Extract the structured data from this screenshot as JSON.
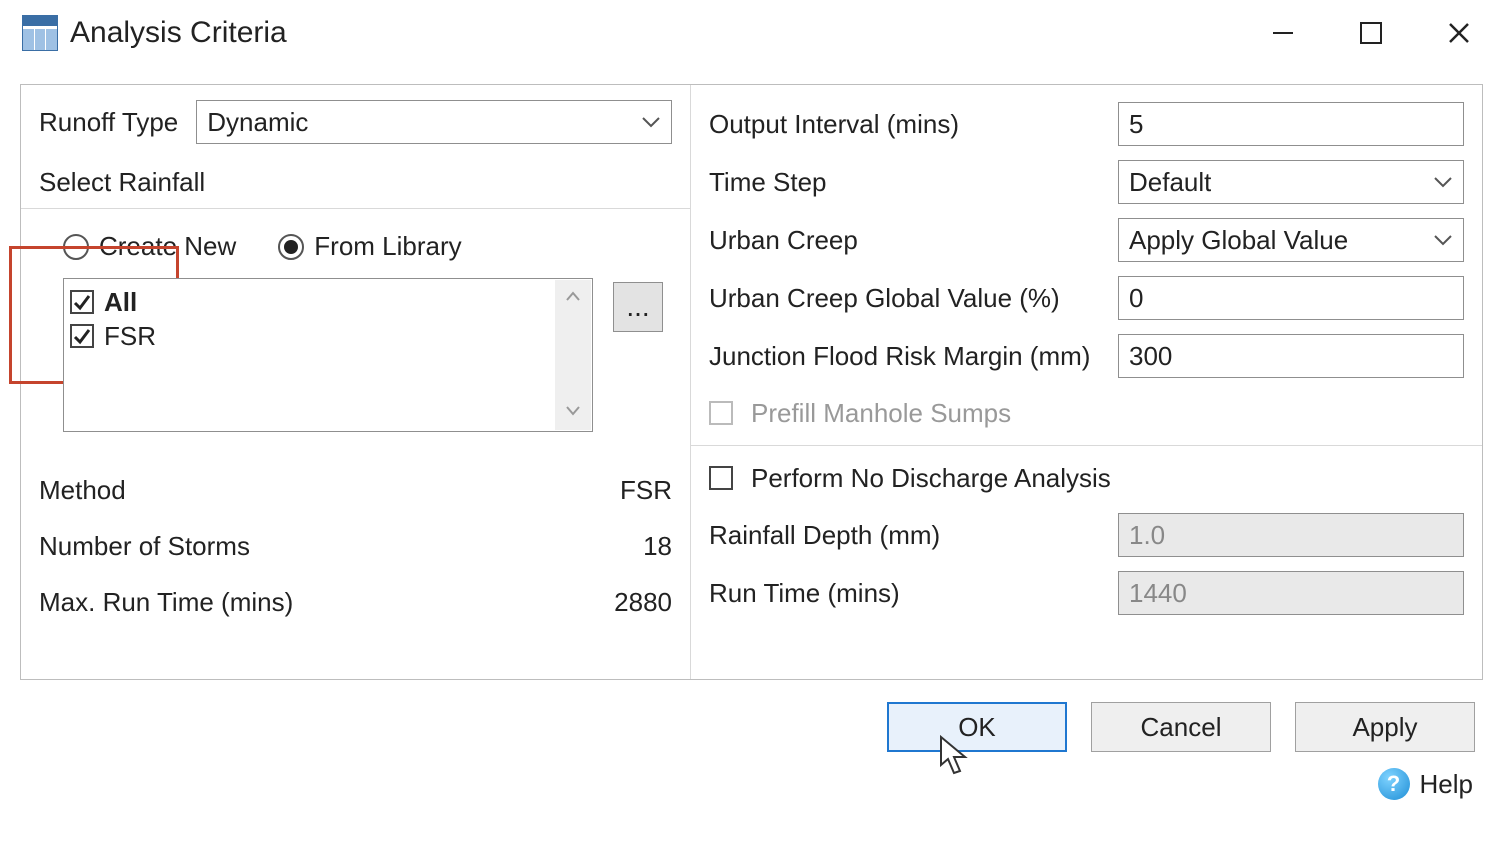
{
  "window": {
    "title": "Analysis Criteria"
  },
  "left": {
    "runoff_type_label": "Runoff Type",
    "runoff_type_value": "Dynamic",
    "select_rainfall_label": "Select Rainfall",
    "radio_create_new": "Create New",
    "radio_from_library": "From Library",
    "rainfall_source": "from_library",
    "library_items": [
      {
        "label": "All",
        "checked": true,
        "bold": true
      },
      {
        "label": "FSR",
        "checked": true,
        "bold": false
      }
    ],
    "browse_label": "...",
    "stats": {
      "method_label": "Method",
      "method_value": "FSR",
      "storms_label": "Number of Storms",
      "storms_value": "18",
      "maxrun_label": "Max. Run Time (mins)",
      "maxrun_value": "2880"
    }
  },
  "right": {
    "output_interval_label": "Output Interval (mins)",
    "output_interval_value": "5",
    "time_step_label": "Time Step",
    "time_step_value": "Default",
    "urban_creep_label": "Urban Creep",
    "urban_creep_value": "Apply Global Value",
    "ucgv_label": "Urban Creep Global Value (%)",
    "ucgv_value": "0",
    "jfrm_label": "Junction Flood Risk Margin (mm)",
    "jfrm_value": "300",
    "prefill_label": "Prefill Manhole Sumps",
    "prefill_checked": false,
    "prefill_enabled": false,
    "no_discharge_label": "Perform No Discharge Analysis",
    "no_discharge_checked": false,
    "rainfall_depth_label": "Rainfall Depth (mm)",
    "rainfall_depth_value": "1.0",
    "runtime_label": "Run Time (mins)",
    "runtime_value": "1440"
  },
  "footer": {
    "ok": "OK",
    "cancel": "Cancel",
    "apply": "Apply",
    "help": "Help"
  }
}
